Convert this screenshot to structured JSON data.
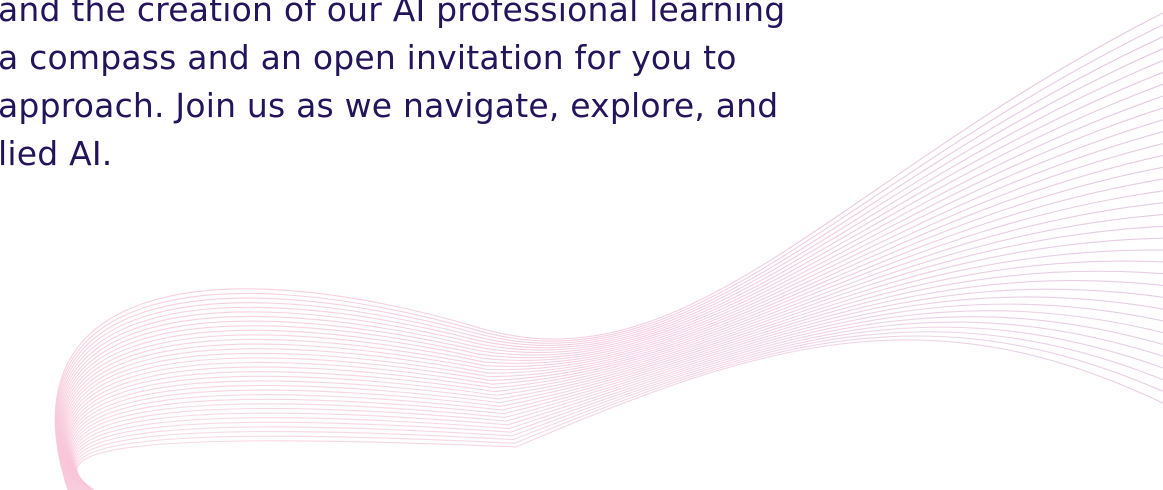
{
  "content": {
    "paragraph_lines": [
      "and the creation of our AI professional learning",
      "a compass and an open invitation for you to",
      "approach. Join us as we navigate, explore, and",
      "lied AI."
    ]
  },
  "decoration": {
    "line_color_start": "#f7c3d6",
    "line_color_end": "#d8b7d8",
    "text_color": "#24145c"
  }
}
